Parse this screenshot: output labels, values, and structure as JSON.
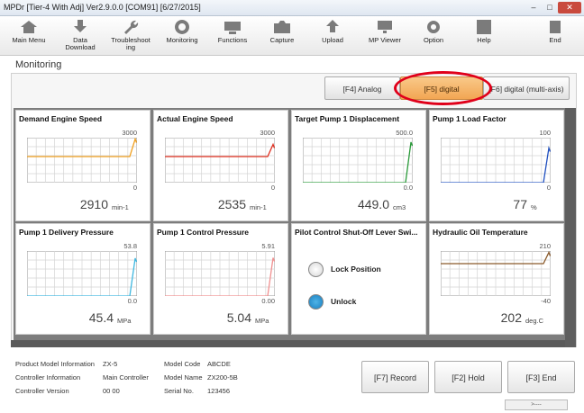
{
  "titlebar": {
    "title": "MPDr [Tier-4 With Adj] Ver2.9.0.0 [COM91] [6/27/2015]",
    "min": "–",
    "max": "□",
    "close": "✕"
  },
  "toolbar": [
    {
      "label": "Main Menu",
      "icon": "home-icon"
    },
    {
      "label": "Data\nDownload",
      "icon": "download-icon"
    },
    {
      "label": "Troubleshoot\ning",
      "icon": "wrench-icon"
    },
    {
      "label": "Monitoring",
      "icon": "monitor-icon"
    },
    {
      "label": "Functions",
      "icon": "functions-icon"
    },
    {
      "label": "Capture",
      "icon": "camera-icon"
    },
    {
      "label": "Upload",
      "icon": "upload-icon"
    },
    {
      "label": "MP Viewer",
      "icon": "viewer-icon"
    },
    {
      "label": "Option",
      "icon": "gear-icon"
    },
    {
      "label": "Help",
      "icon": "help-icon"
    },
    {
      "label": "End",
      "icon": "power-icon"
    }
  ],
  "page": {
    "title": "Monitoring"
  },
  "tabs": [
    {
      "label": "[F4] Analog"
    },
    {
      "label": "[F5] digital"
    },
    {
      "label": "[F6] digital (multi-axis)"
    }
  ],
  "tiles": [
    {
      "title": "Demand Engine Speed",
      "max": "3000",
      "min": "0",
      "value": "2910",
      "unit": "min-1",
      "color": "#f0a020",
      "level": 0.58,
      "end": 0.97
    },
    {
      "title": "Actual Engine Speed",
      "max": "3000",
      "min": "0",
      "value": "2535",
      "unit": "min-1",
      "color": "#e03020",
      "level": 0.58,
      "end": 0.85
    },
    {
      "title": "Target Pump 1 Displacement",
      "max": "500.0",
      "min": "0.0",
      "value": "449.0",
      "unit": "cm3",
      "color": "#2a9a3a",
      "level": 0.0,
      "end": 0.9
    },
    {
      "title": "Pump 1 Load Factor",
      "max": "100",
      "min": "0",
      "value": "77",
      "unit": "%",
      "color": "#2050c0",
      "level": 0.0,
      "end": 0.77
    },
    {
      "title": "Pump 1 Delivery Pressure",
      "max": "53.8",
      "min": "0.0",
      "value": "45.4",
      "unit": "MPa",
      "color": "#40b8e0",
      "level": 0.0,
      "end": 0.84
    },
    {
      "title": "Pump 1 Control Pressure",
      "max": "5.91",
      "min": "0.00",
      "value": "5.04",
      "unit": "MPa",
      "color": "#f09090",
      "level": 0.0,
      "end": 0.85
    },
    {
      "title": "Pilot Control Shut-Off Lever Swi...",
      "items": [
        "Lock Position",
        "Unlock"
      ]
    },
    {
      "title": "Hydraulic Oil Temperature",
      "max": "210",
      "min": "-40",
      "value": "202",
      "unit": "deg.C",
      "color": "#8a5a2a",
      "level": 0.72,
      "end": 0.97
    }
  ],
  "info": {
    "product_model_label": "Product Model Information",
    "product_model": "ZX-5",
    "controller_info_label": "Controller Information",
    "controller_info": "Main Controller",
    "controller_version_label": "Controller Version",
    "controller_version": "00 00",
    "model_code_label": "Model Code",
    "model_code": "ABCDE",
    "model_name_label": "Model Name",
    "model_name": "ZX200-5B",
    "serial_label": "Serial No.",
    "serial": "123456"
  },
  "buttons": {
    "record": "[F7] Record",
    "hold": "[F2] Hold",
    "end": "[F3] End"
  },
  "scroll_tab": ">----"
}
